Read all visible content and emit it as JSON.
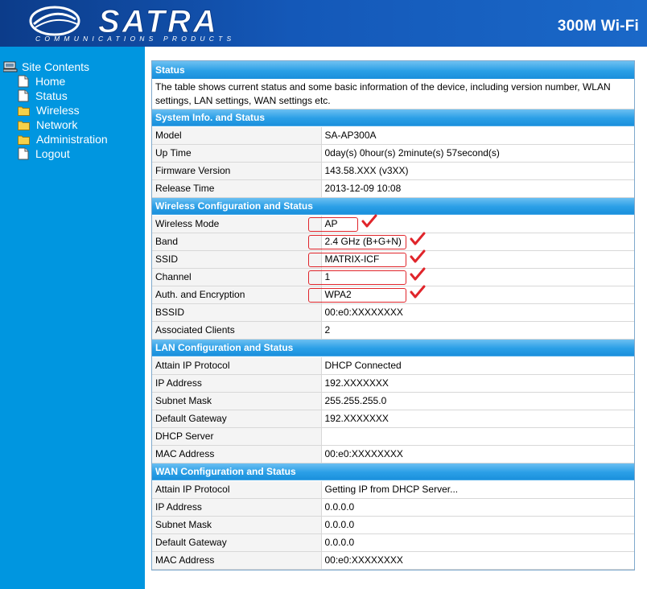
{
  "header": {
    "logo_text": "SATRA",
    "logo_tagline": "COMMUNICATIONS PRODUCTS",
    "product_title": "300M Wi-Fi"
  },
  "sidebar": {
    "root_label": "Site Contents",
    "items": [
      {
        "label": "Home",
        "icon": "page-icon"
      },
      {
        "label": "Status",
        "icon": "page-icon"
      },
      {
        "label": "Wireless",
        "icon": "folder-icon"
      },
      {
        "label": "Network",
        "icon": "folder-icon"
      },
      {
        "label": "Administration",
        "icon": "folder-icon"
      },
      {
        "label": "Logout",
        "icon": "page-icon"
      }
    ]
  },
  "status": {
    "title": "Status",
    "description": "The table shows current status and some basic information of the device, including version number, WLAN settings, LAN settings, WAN settings etc."
  },
  "system": {
    "title": "System Info. and Status",
    "rows": [
      {
        "label": "Model",
        "value": "SA-AP300A"
      },
      {
        "label": "Up Time",
        "value": "0day(s) 0hour(s) 2minute(s) 57second(s)"
      },
      {
        "label": "Firmware Version",
        "value": "143.58.XXX  (v3XX)"
      },
      {
        "label": "Release Time",
        "value": "2013-12-09 10:08"
      }
    ]
  },
  "wireless": {
    "title": "Wireless Configuration and Status",
    "rows": [
      {
        "label": "Wireless Mode",
        "value": "AP"
      },
      {
        "label": "Band",
        "value": "2.4 GHz (B+G+N)"
      },
      {
        "label": "SSID",
        "value": "MATRIX-ICF"
      },
      {
        "label": "Channel",
        "value": "1"
      },
      {
        "label": "Auth. and Encryption",
        "value": "WPA2"
      },
      {
        "label": "BSSID",
        "value": "00:e0:XXXXXXXX"
      },
      {
        "label": "Associated Clients",
        "value": "2"
      }
    ]
  },
  "lan": {
    "title": "LAN Configuration and Status",
    "rows": [
      {
        "label": "Attain IP Protocol",
        "value": "DHCP Connected"
      },
      {
        "label": "IP Address",
        "value": "192.XXXXXXX"
      },
      {
        "label": "Subnet Mask",
        "value": "255.255.255.0"
      },
      {
        "label": "Default Gateway",
        "value": "192.XXXXXXX"
      },
      {
        "label": "DHCP Server",
        "value": ""
      },
      {
        "label": "MAC Address",
        "value": "00:e0:XXXXXXXX"
      }
    ]
  },
  "wan": {
    "title": "WAN Configuration and Status",
    "rows": [
      {
        "label": "Attain IP Protocol",
        "value": "Getting IP from DHCP Server..."
      },
      {
        "label": "IP Address",
        "value": "0.0.0.0"
      },
      {
        "label": "Subnet Mask",
        "value": "0.0.0.0"
      },
      {
        "label": "Default Gateway",
        "value": "0.0.0.0"
      },
      {
        "label": "MAC Address",
        "value": "00:e0:XXXXXXXX"
      }
    ]
  },
  "annotation_color": "#e0252b",
  "colors": {
    "header": "#1458b8",
    "sidebar": "#0096e0",
    "section_bar": "#2a9fe6"
  }
}
